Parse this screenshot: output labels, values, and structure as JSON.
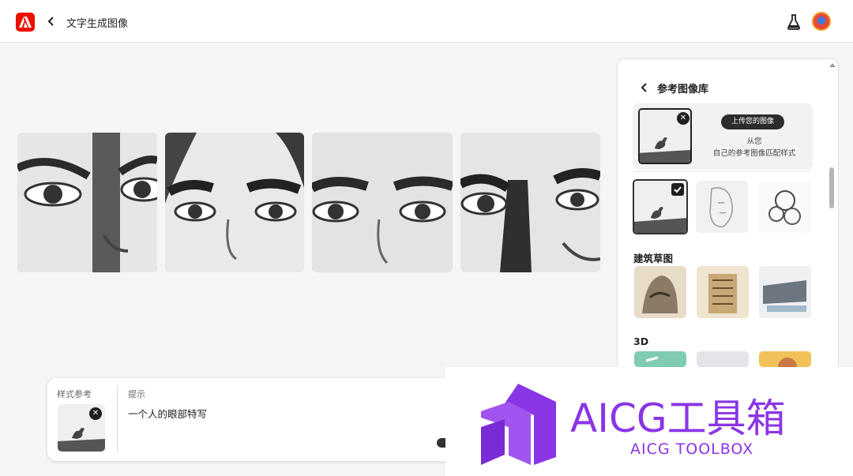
{
  "header": {
    "app_title": "文字生成图像",
    "logo_icon": "adobe-logo-icon",
    "back_icon": "chevron-left-icon",
    "labs_icon": "flask-icon",
    "avatar_icon": "avatar"
  },
  "results": {
    "images": [
      {
        "name": "generated-image-1"
      },
      {
        "name": "generated-image-2"
      },
      {
        "name": "generated-image-3"
      },
      {
        "name": "generated-image-4"
      }
    ]
  },
  "panel": {
    "title": "参考图像库",
    "upload": {
      "button_label": "上传您的图像",
      "line1": "从您",
      "line2": "自己的参考图像匹配样式"
    },
    "sections": [
      {
        "label": "建筑草图"
      },
      {
        "label": "3D"
      }
    ]
  },
  "prompt_bar": {
    "style_ref_label": "样式参考",
    "prompt_label": "提示",
    "prompt_text": "一个人的眼部特写"
  },
  "watermark": {
    "title": "AICG工具箱",
    "subtitle": "AICG TOOLBOX"
  },
  "colors": {
    "accent_red": "#eb1000",
    "watermark_purple": "#8a35e6"
  }
}
